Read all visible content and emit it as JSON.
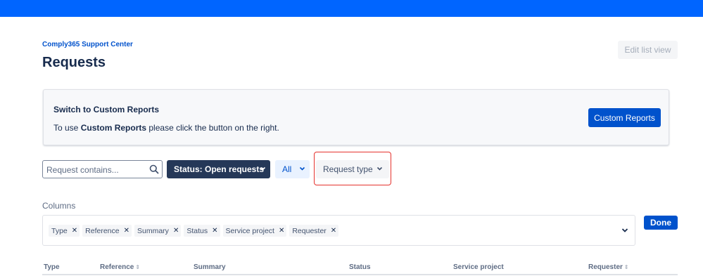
{
  "colors": {
    "topbar": "#0065ff",
    "primary": "#0052cc",
    "dark": "#253858",
    "highlight": "#e5322d"
  },
  "breadcrumb": "Comply365 Support Center",
  "page_title": "Requests",
  "edit_button": "Edit list view",
  "banner": {
    "title": "Switch to Custom Reports",
    "text_before": "To use ",
    "text_bold": "Custom Reports",
    "text_after": " please click the button on the right.",
    "button": "Custom Reports"
  },
  "filters": {
    "search_placeholder": "Request contains...",
    "search_icon": "search-icon",
    "status": "Status: Open requests",
    "all": "All",
    "request_type": "Request type"
  },
  "columns": {
    "label": "Columns",
    "tags": [
      "Type",
      "Reference",
      "Summary",
      "Status",
      "Service project",
      "Requester"
    ],
    "remove_glyph": "✕",
    "done": "Done"
  },
  "table": {
    "headers": [
      "Type",
      "Reference",
      "Summary",
      "Status",
      "Service project",
      "Requester"
    ]
  }
}
